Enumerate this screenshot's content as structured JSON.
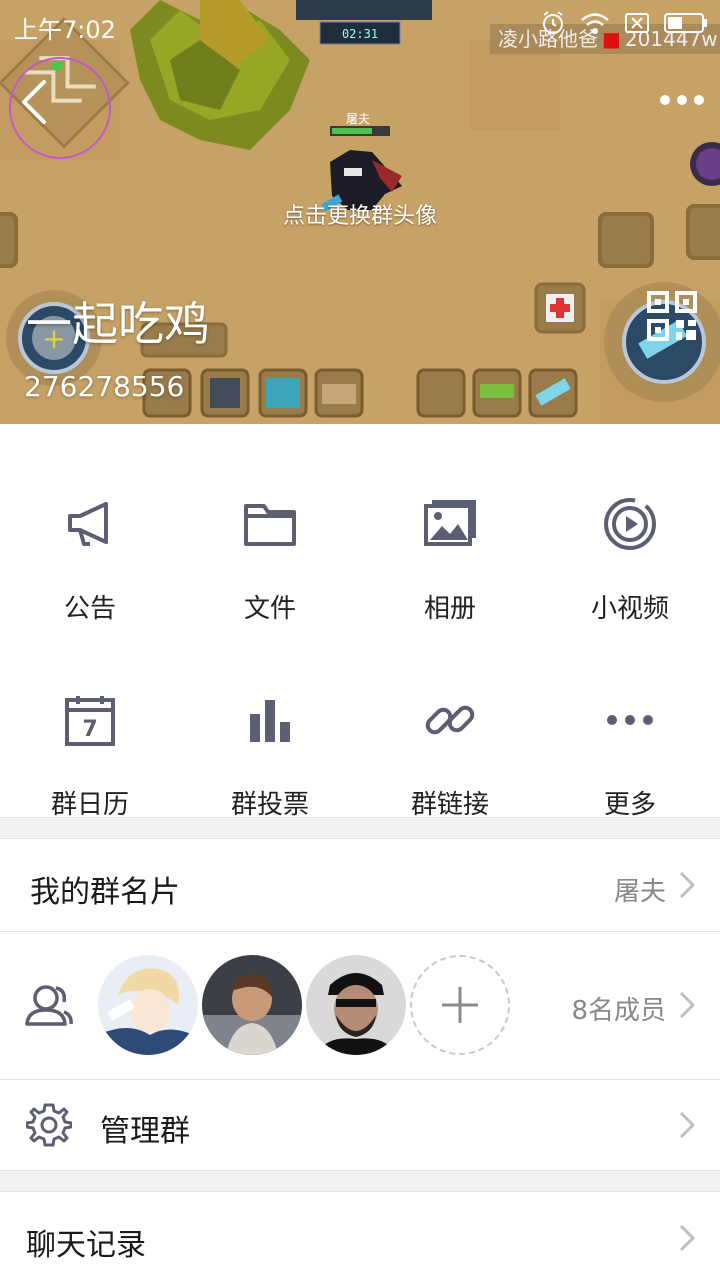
{
  "status_bar": {
    "time": "上午7:02",
    "game_overlay_left": "凌小路他爸",
    "game_overlay_right": "201447w"
  },
  "header": {
    "player_name": "屠夫",
    "change_avatar_text": "点击更换群头像",
    "group_name": "一起吃鸡",
    "group_id": "276278556",
    "timer": "02:31"
  },
  "features": [
    {
      "label": "公告",
      "icon": "megaphone-icon"
    },
    {
      "label": "文件",
      "icon": "folder-icon"
    },
    {
      "label": "相册",
      "icon": "album-icon"
    },
    {
      "label": "小视频",
      "icon": "video-icon"
    },
    {
      "label": "群日历",
      "icon": "calendar-icon"
    },
    {
      "label": "群投票",
      "icon": "bar-chart-icon"
    },
    {
      "label": "群链接",
      "icon": "link-icon"
    },
    {
      "label": "更多",
      "icon": "more-icon"
    }
  ],
  "calendar_day": "7",
  "my_card": {
    "title": "我的群名片",
    "value": "屠夫"
  },
  "members": {
    "count_text": "8名成员"
  },
  "manage": {
    "title": "管理群"
  },
  "chat_history": {
    "title": "聊天记录"
  },
  "colors": {
    "icon": "#5c5f74",
    "separator": "#f2f2f4",
    "chevron": "#bdbdc2"
  }
}
